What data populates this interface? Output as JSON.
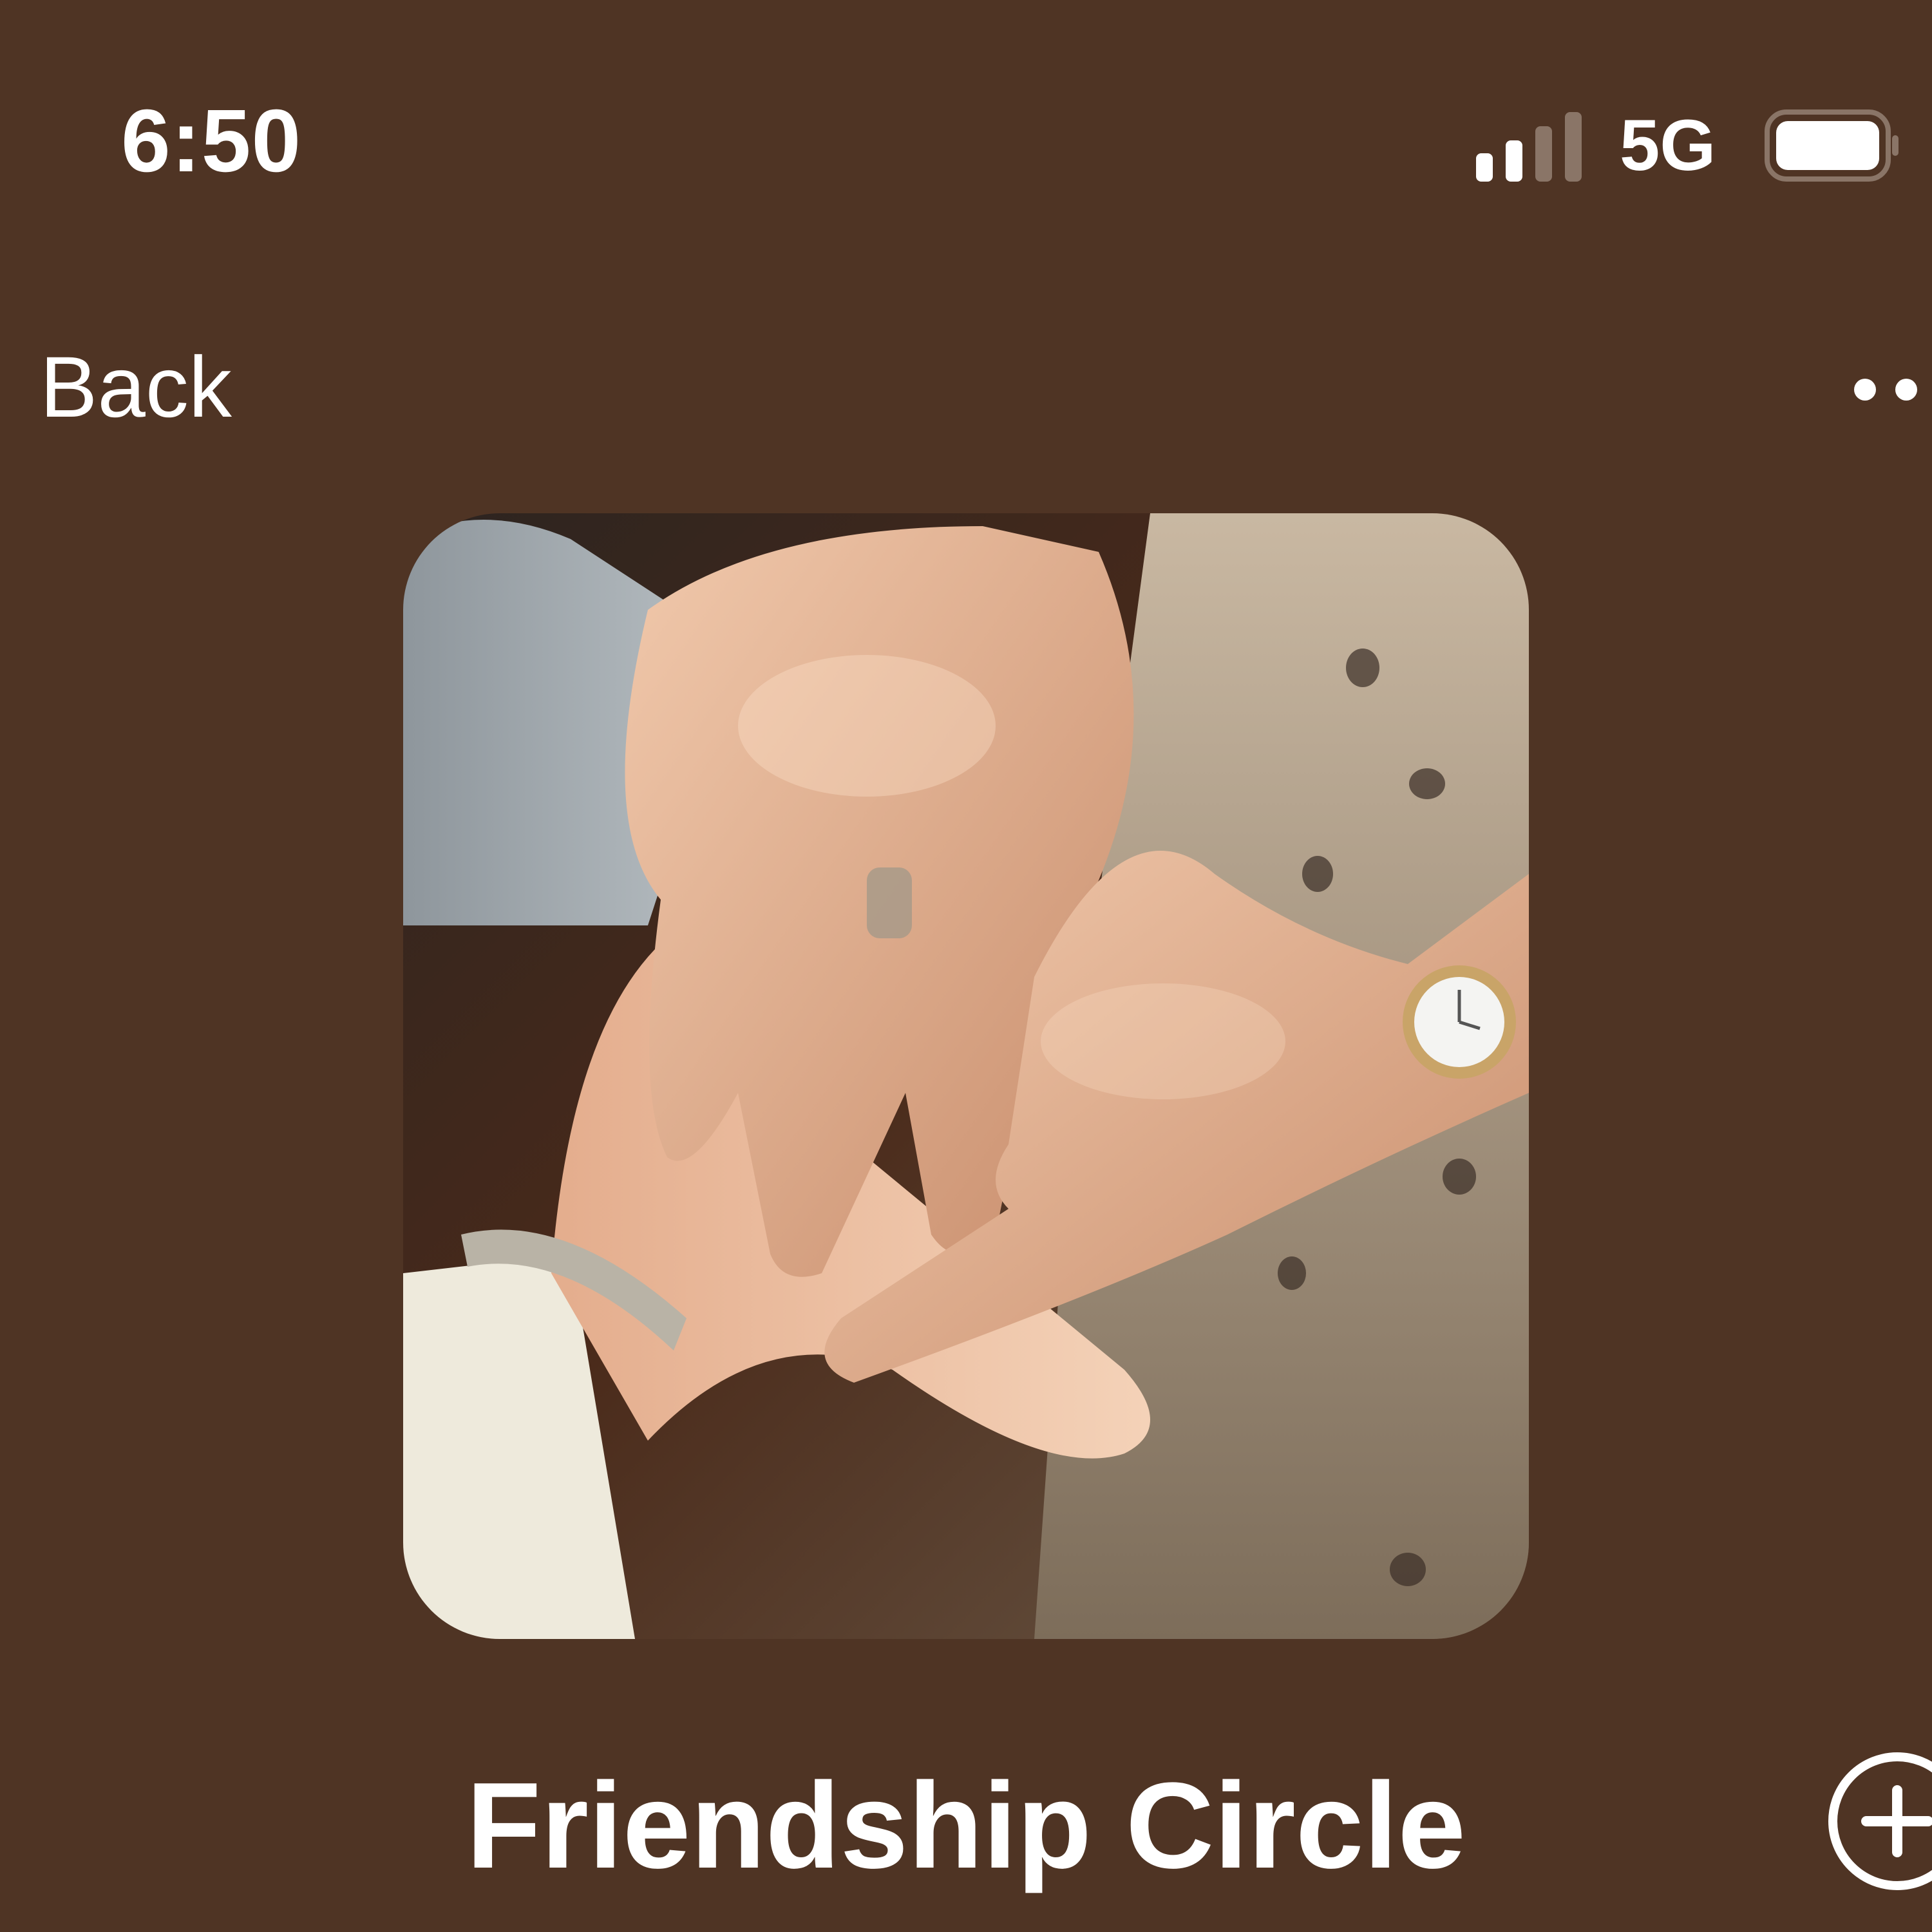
{
  "status_bar": {
    "time": "6:50",
    "network": "5G",
    "signal_bars_active": 2,
    "signal_bars_total": 4,
    "battery_level": 1.0
  },
  "navigation": {
    "back_label": "Back",
    "more_icon": "more-horizontal-icon"
  },
  "circle": {
    "cover_image": "stacked-hands-photo",
    "title": "Friendship Circle",
    "add_icon": "plus-circle-icon"
  },
  "colors": {
    "background": "#4f3424",
    "text": "#ffffff",
    "inactive_signal": "#8a7567"
  }
}
